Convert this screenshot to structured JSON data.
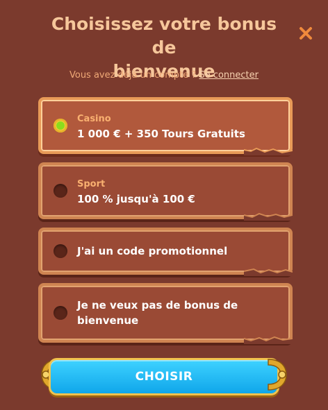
{
  "modal": {
    "title_line1": "Choisissez votre bonus de",
    "title_line2": "bienvenue",
    "subtitle": "Vous avez déjà un compte ?",
    "login_link": "Se connecter"
  },
  "options": [
    {
      "tag": "Casino",
      "text": "1 000 € + 350 Tours Gratuits",
      "selected": true
    },
    {
      "tag": "Sport",
      "text": "100 % jusqu'à 100 €",
      "selected": false
    },
    {
      "tag": "",
      "text": "J'ai un code promotionnel",
      "selected": false
    },
    {
      "tag": "",
      "text": "Je ne veux pas de bonus de bienvenue",
      "selected": false
    }
  ],
  "cta": {
    "label": "CHOISIR"
  },
  "icons": {
    "close": "close-icon"
  },
  "colors": {
    "background": "#7b3a2d",
    "title": "#f6c79b",
    "accent_orange": "#f08a3c",
    "button": "#1bb6f3"
  }
}
